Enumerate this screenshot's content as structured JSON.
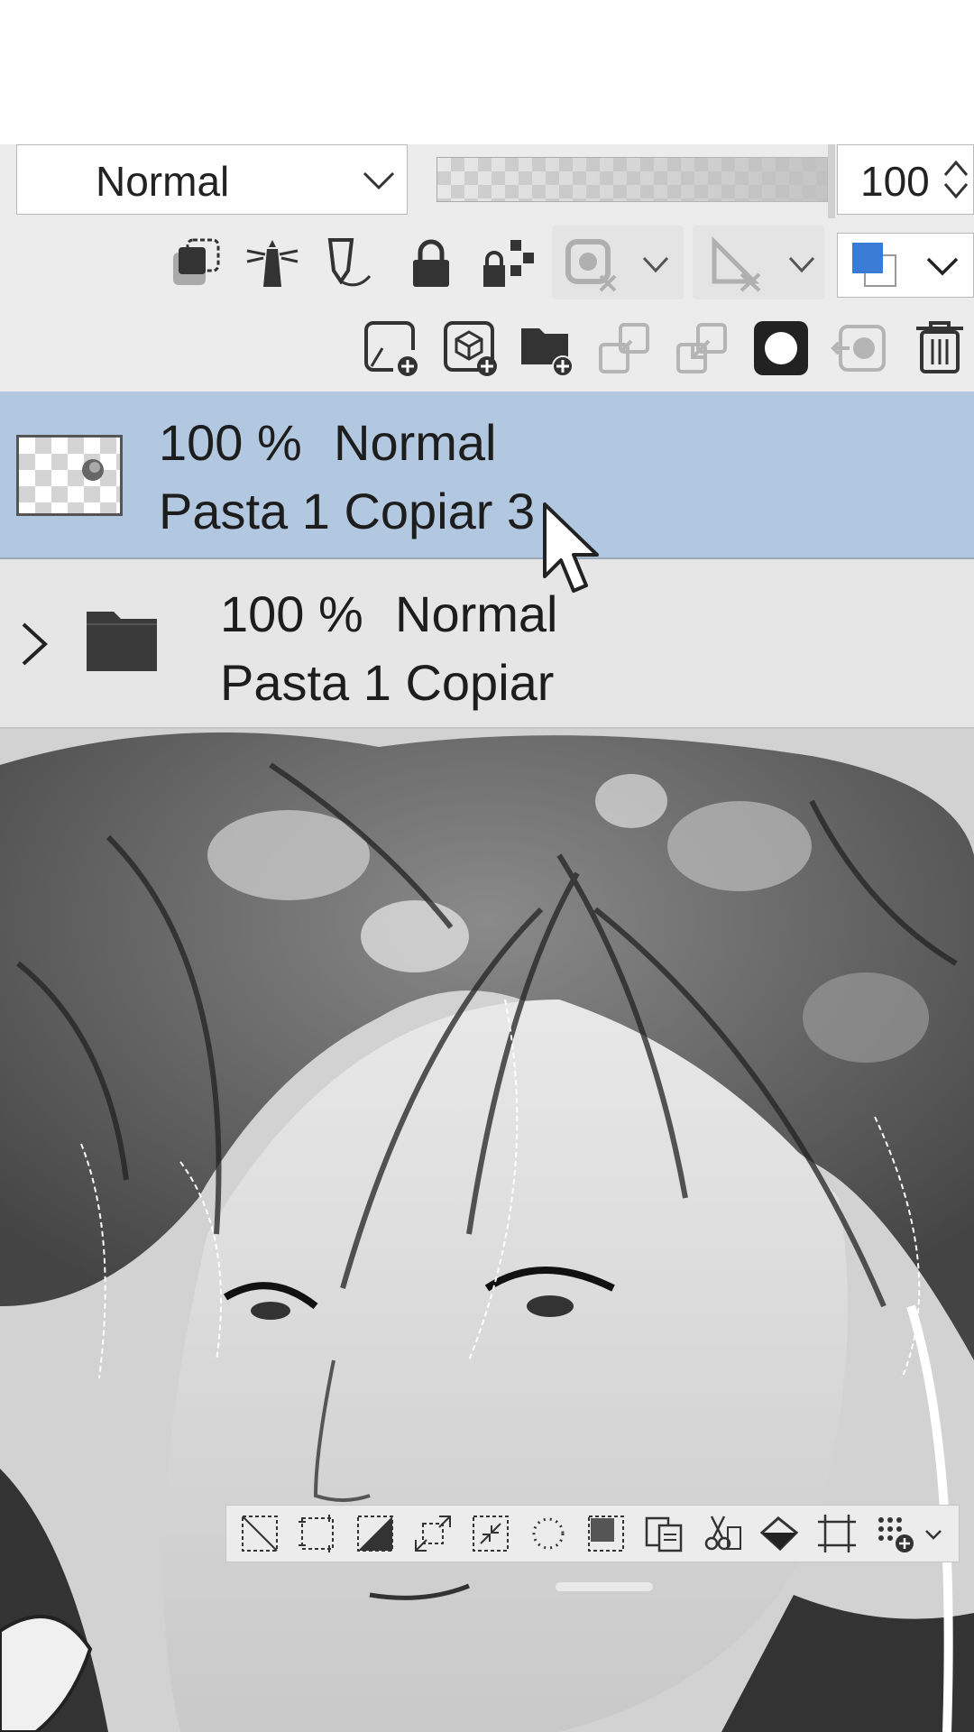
{
  "blend_mode": {
    "value": "Normal"
  },
  "opacity": {
    "value": "100"
  },
  "layer_property_icons": [
    "clip-to-layer-below-icon",
    "reference-layer-icon",
    "draft-layer-icon",
    "lock-layer-icon",
    "lock-transparent-pixels-icon",
    "mask-icon",
    "ruler-icon",
    "layer-color-icon"
  ],
  "layer_action_icons": [
    "new-raster-layer-icon",
    "new-vector-layer-icon",
    "new-folder-icon",
    "transfer-to-lower-layer-icon",
    "combine-with-layer-below-icon",
    "create-layer-mask-icon",
    "apply-mask-icon",
    "delete-layer-icon"
  ],
  "layers": [
    {
      "opacity": "100 %",
      "blend": "Normal",
      "name": "Pasta 1 Copiar 3",
      "selected": true
    },
    {
      "opacity": "100 %",
      "blend": "Normal",
      "name": "Pasta 1 Copiar",
      "selected": false
    }
  ],
  "selection_toolbar_icons": [
    "deselect-icon",
    "select-all-icon",
    "invert-selection-icon",
    "expand-selection-icon",
    "shrink-selection-icon",
    "selection-outline-icon",
    "select-image-area-icon",
    "copy-paste-icon",
    "cut-paste-icon",
    "fill-icon",
    "scale-rotate-icon",
    "selection-launcher-icon",
    "more-chevron-icon"
  ],
  "colors": {
    "selected_layer": "#b2c8e0",
    "panel": "#ececec",
    "color_swatch": "#3a7bd5"
  }
}
